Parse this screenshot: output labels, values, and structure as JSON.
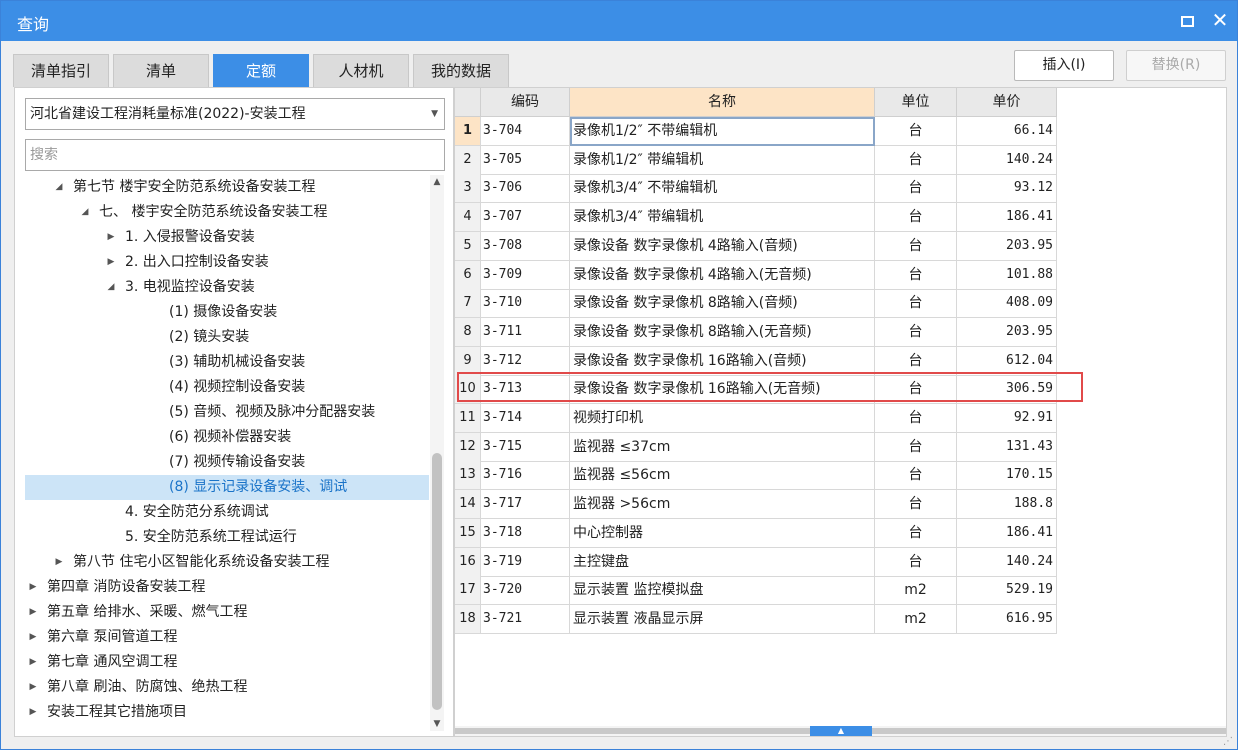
{
  "window": {
    "title": "查询",
    "maximize_icon": "maximize-icon",
    "close_glyph": "✕"
  },
  "tabs": [
    {
      "label": "清单指引",
      "active": false
    },
    {
      "label": "清单",
      "active": false
    },
    {
      "label": "定额",
      "active": true
    },
    {
      "label": "人材机",
      "active": false
    },
    {
      "label": "我的数据",
      "active": false
    }
  ],
  "buttons": {
    "insert": "插入(I)",
    "replace": "替换(R)"
  },
  "left": {
    "selected_library": "河北省建设工程消耗量标准(2022)-安装工程",
    "search_placeholder": "搜索",
    "tree": [
      {
        "label": "第七节 楼宇安全防范系统设备安装工程",
        "arrow": "◢",
        "level": 0
      },
      {
        "label": "七、 楼宇安全防范系统设备安装工程",
        "arrow": "◢",
        "level": 1
      },
      {
        "label": "1. 入侵报警设备安装",
        "arrow": "▶",
        "level": 2
      },
      {
        "label": "2. 出入口控制设备安装",
        "arrow": "▶",
        "level": 2
      },
      {
        "label": "3. 电视监控设备安装",
        "arrow": "◢",
        "level": 2
      },
      {
        "label": "(1) 摄像设备安装",
        "arrow": "",
        "level": 3
      },
      {
        "label": "(2) 镜头安装",
        "arrow": "",
        "level": 3
      },
      {
        "label": "(3) 辅助机械设备安装",
        "arrow": "",
        "level": 3
      },
      {
        "label": "(4) 视频控制设备安装",
        "arrow": "",
        "level": 3
      },
      {
        "label": "(5) 音频、视频及脉冲分配器安装",
        "arrow": "",
        "level": 3
      },
      {
        "label": "(6) 视频补偿器安装",
        "arrow": "",
        "level": 3
      },
      {
        "label": "(7) 视频传输设备安装",
        "arrow": "",
        "level": 3
      },
      {
        "label": "(8) 显示记录设备安装、调试",
        "arrow": "",
        "level": 3,
        "selected": true
      },
      {
        "label": "4. 安全防范分系统调试",
        "arrow": "",
        "level": 2
      },
      {
        "label": "5. 安全防范系统工程试运行",
        "arrow": "",
        "level": 2
      },
      {
        "label": "第八节 住宅小区智能化系统设备安装工程",
        "arrow": "▶",
        "level": 0
      },
      {
        "label": "第四章 消防设备安装工程",
        "arrow": "▶",
        "level": -1
      },
      {
        "label": "第五章 给排水、采暖、燃气工程",
        "arrow": "▶",
        "level": -1
      },
      {
        "label": "第六章 泵间管道工程",
        "arrow": "▶",
        "level": -1
      },
      {
        "label": "第七章 通风空调工程",
        "arrow": "▶",
        "level": -1
      },
      {
        "label": "第八章 刷油、防腐蚀、绝热工程",
        "arrow": "▶",
        "level": -1
      },
      {
        "label": "安装工程其它措施项目",
        "arrow": "▶",
        "level": -1
      }
    ]
  },
  "table": {
    "columns": [
      "",
      "编码",
      "名称",
      "单位",
      "单价"
    ],
    "current_row": 1,
    "highlighted_row": 10,
    "rows": [
      {
        "n": "1",
        "code": "3-704",
        "name": "录像机1/2″  不带编辑机",
        "unit": "台",
        "price": "66.14"
      },
      {
        "n": "2",
        "code": "3-705",
        "name": "录像机1/2″  带编辑机",
        "unit": "台",
        "price": "140.24"
      },
      {
        "n": "3",
        "code": "3-706",
        "name": "录像机3/4″  不带编辑机",
        "unit": "台",
        "price": "93.12"
      },
      {
        "n": "4",
        "code": "3-707",
        "name": "录像机3/4″  带编辑机",
        "unit": "台",
        "price": "186.41"
      },
      {
        "n": "5",
        "code": "3-708",
        "name": "录像设备 数字录像机 4路输入(音频)",
        "unit": "台",
        "price": "203.95"
      },
      {
        "n": "6",
        "code": "3-709",
        "name": "录像设备 数字录像机 4路输入(无音频)",
        "unit": "台",
        "price": "101.88"
      },
      {
        "n": "7",
        "code": "3-710",
        "name": "录像设备 数字录像机 8路输入(音频)",
        "unit": "台",
        "price": "408.09"
      },
      {
        "n": "8",
        "code": "3-711",
        "name": "录像设备 数字录像机 8路输入(无音频)",
        "unit": "台",
        "price": "203.95"
      },
      {
        "n": "9",
        "code": "3-712",
        "name": "录像设备 数字录像机 16路输入(音频)",
        "unit": "台",
        "price": "612.04"
      },
      {
        "n": "10",
        "code": "3-713",
        "name": "录像设备 数字录像机 16路输入(无音频)",
        "unit": "台",
        "price": "306.59"
      },
      {
        "n": "11",
        "code": "3-714",
        "name": "视频打印机",
        "unit": "台",
        "price": "92.91"
      },
      {
        "n": "12",
        "code": "3-715",
        "name": "监视器 ≤37cm",
        "unit": "台",
        "price": "131.43"
      },
      {
        "n": "13",
        "code": "3-716",
        "name": "监视器 ≤56cm",
        "unit": "台",
        "price": "170.15"
      },
      {
        "n": "14",
        "code": "3-717",
        "name": "监视器 >56cm",
        "unit": "台",
        "price": "188.8"
      },
      {
        "n": "15",
        "code": "3-718",
        "name": "中心控制器",
        "unit": "台",
        "price": "186.41"
      },
      {
        "n": "16",
        "code": "3-719",
        "name": "主控键盘",
        "unit": "台",
        "price": "140.24"
      },
      {
        "n": "17",
        "code": "3-720",
        "name": "显示装置 监控模拟盘",
        "unit": "m2",
        "price": "529.19"
      },
      {
        "n": "18",
        "code": "3-721",
        "name": "显示装置 液晶显示屏",
        "unit": "m2",
        "price": "616.95"
      }
    ]
  },
  "colors": {
    "accent": "#3c8ee6",
    "selected_bg": "#cce4f7",
    "header_active": "#fde4c6",
    "highlight_border": "#e14a4a"
  }
}
